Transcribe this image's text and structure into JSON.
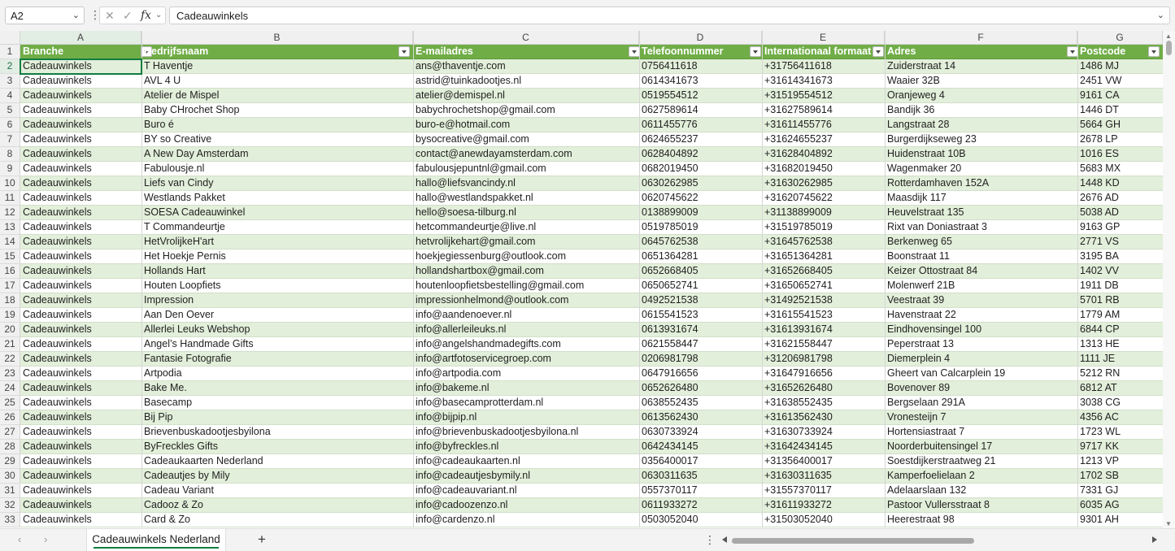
{
  "formula_bar": {
    "name_box": "A2",
    "cancel_icon": "✕",
    "confirm_icon": "✓",
    "fx": "fx",
    "formula": "Cadeauwinkels"
  },
  "column_letters": [
    "A",
    "B",
    "C",
    "D",
    "E",
    "F",
    "G"
  ],
  "headers": [
    "Branche",
    "Bedrijfsnaam",
    "E-mailadres",
    "Telefoonnummer",
    "Internationaal formaat",
    "Adres",
    "Postcode"
  ],
  "rows": [
    [
      "Cadeauwinkels",
      "T Haventje",
      "ans@thaventje.com",
      "0756411618",
      "+31756411618",
      "Zuiderstraat 14",
      "1486 MJ"
    ],
    [
      "Cadeauwinkels",
      "AVL 4 U",
      "astrid@tuinkadootjes.nl",
      "0614341673",
      "+31614341673",
      "Waaier 32B",
      "2451 VW"
    ],
    [
      "Cadeauwinkels",
      "Atelier de Mispel",
      "atelier@demispel.nl",
      "0519554512",
      "+31519554512",
      "Oranjeweg 4",
      "9161 CA"
    ],
    [
      "Cadeauwinkels",
      "Baby CHrochet Shop",
      "babychrochetshop@gmail.com",
      "0627589614",
      "+31627589614",
      "Bandijk 36",
      "1446 DT"
    ],
    [
      "Cadeauwinkels",
      "Buro é",
      "buro-e@hotmail.com",
      "0611455776",
      "+31611455776",
      "Langstraat 28",
      "5664 GH"
    ],
    [
      "Cadeauwinkels",
      "BY so Creative",
      "bysocreative@gmail.com",
      "0624655237",
      "+31624655237",
      "Burgerdijkseweg 23",
      "2678 LP"
    ],
    [
      "Cadeauwinkels",
      "A New Day Amsterdam",
      "contact@anewdayamsterdam.com",
      "0628404892",
      "+31628404892",
      "Huidenstraat 10B",
      "1016 ES"
    ],
    [
      "Cadeauwinkels",
      "Fabulousje.nl",
      "fabulousjepuntnl@gmail.com",
      "0682019450",
      "+31682019450",
      "Wagenmaker 20",
      "5683 MX"
    ],
    [
      "Cadeauwinkels",
      "Liefs van Cindy",
      "hallo@liefsvancindy.nl",
      "0630262985",
      "+31630262985",
      "Rotterdamhaven 152A",
      "1448 KD"
    ],
    [
      "Cadeauwinkels",
      "Westlands Pakket",
      "hallo@westlandspakket.nl",
      "0620745622",
      "+31620745622",
      "Maasdijk 117",
      "2676 AD"
    ],
    [
      "Cadeauwinkels",
      "SOESA Cadeauwinkel",
      "hello@soesa-tilburg.nl",
      "0138899009",
      "+31138899009",
      "Heuvelstraat 135",
      "5038 AD"
    ],
    [
      "Cadeauwinkels",
      "T Commandeurtje",
      "hetcommandeurtje@live.nl",
      "0519785019",
      "+31519785019",
      "Rixt van Doniastraat 3",
      "9163 GP"
    ],
    [
      "Cadeauwinkels",
      "HetVrolijkeH'art",
      "hetvrolijkehart@gmail.com",
      "0645762538",
      "+31645762538",
      "Berkenweg 65",
      "2771 VS"
    ],
    [
      "Cadeauwinkels",
      "Het Hoekje Pernis",
      "hoekjegiessenburg@outlook.com",
      "0651364281",
      "+31651364281",
      "Boonstraat 11",
      "3195 BA"
    ],
    [
      "Cadeauwinkels",
      "Hollands Hart",
      "hollandshartbox@gmail.com",
      "0652668405",
      "+31652668405",
      "Keizer Ottostraat 84",
      "1402 VV"
    ],
    [
      "Cadeauwinkels",
      "Houten Loopfiets",
      "houtenloopfietsbestelling@gmail.com",
      "0650652741",
      "+31650652741",
      "Molenwerf 21B",
      "1911 DB"
    ],
    [
      "Cadeauwinkels",
      "Impression",
      "impressionhelmond@outlook.com",
      "0492521538",
      "+31492521538",
      "Veestraat 39",
      "5701 RB"
    ],
    [
      "Cadeauwinkels",
      "Aan Den Oever",
      "info@aandenoever.nl",
      "0615541523",
      "+31615541523",
      "Havenstraat 22",
      "1779 AM"
    ],
    [
      "Cadeauwinkels",
      "Allerlei Leuks Webshop",
      "info@allerleileuks.nl",
      "0613931674",
      "+31613931674",
      "Eindhovensingel 100",
      "6844 CP"
    ],
    [
      "Cadeauwinkels",
      "Angel’s Handmade Gifts",
      "info@angelshandmadegifts.com",
      "0621558447",
      "+31621558447",
      "Peperstraat 13",
      "1313 HE"
    ],
    [
      "Cadeauwinkels",
      "Fantasie Fotografie",
      "info@artfotoservicegroep.com",
      "0206981798",
      "+31206981798",
      "Diemerplein 4",
      "1111 JE"
    ],
    [
      "Cadeauwinkels",
      "Artpodia",
      "info@artpodia.com",
      "0647916656",
      "+31647916656",
      "Gheert van Calcarplein 19",
      "5212 RN"
    ],
    [
      "Cadeauwinkels",
      "Bake Me.",
      "info@bakeme.nl",
      "0652626480",
      "+31652626480",
      "Bovenover 89",
      "6812 AT"
    ],
    [
      "Cadeauwinkels",
      "Basecamp",
      "info@basecamprotterdam.nl",
      "0638552435",
      "+31638552435",
      "Bergselaan 291A",
      "3038 CG"
    ],
    [
      "Cadeauwinkels",
      "Bij Pip",
      "info@bijpip.nl",
      "0613562430",
      "+31613562430",
      "Vronesteijn 7",
      "4356 AC"
    ],
    [
      "Cadeauwinkels",
      "Brievenbuskadootjesbyilona",
      "info@brievenbuskadootjesbyilona.nl",
      "0630733924",
      "+31630733924",
      "Hortensiastraat 7",
      "1723 WL"
    ],
    [
      "Cadeauwinkels",
      "ByFreckles Gifts",
      "info@byfreckles.nl",
      "0642434145",
      "+31642434145",
      "Noorderbuitensingel 17",
      "9717 KK"
    ],
    [
      "Cadeauwinkels",
      "Cadeaukaarten Nederland",
      "info@cadeaukaarten.nl",
      "0356400017",
      "+31356400017",
      "Soestdijkerstraatweg 21",
      "1213 VP"
    ],
    [
      "Cadeauwinkels",
      "Cadeautjes by Mily",
      "info@cadeautjesbymily.nl",
      "0630311635",
      "+31630311635",
      "Kamperfoelielaan 2",
      "1702 SB"
    ],
    [
      "Cadeauwinkels",
      "Cadeau Variant",
      "info@cadeauvariant.nl",
      "0557370117",
      "+31557370117",
      "Adelaarslaan 132",
      "7331 GJ"
    ],
    [
      "Cadeauwinkels",
      "Cadooz & Zo",
      "info@cadoozenzo.nl",
      "0611933272",
      "+31611933272",
      "Pastoor Vullersstraat 8",
      "6035 AG"
    ],
    [
      "Cadeauwinkels",
      "Card & Zo",
      "info@cardenzo.nl",
      "0503052040",
      "+31503052040",
      "Heerestraat 98",
      "9301 AH"
    ]
  ],
  "sheet_tab": "Cadeauwinkels Nederland",
  "add_sheet": "+",
  "colors": {
    "header_green": "#70ad47",
    "band_green": "#e2efda",
    "accent": "#107c41"
  }
}
